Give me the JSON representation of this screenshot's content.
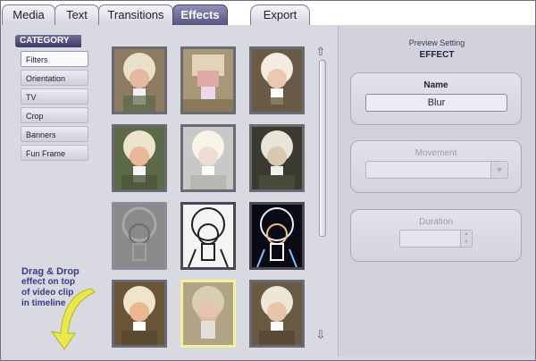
{
  "tabs": {
    "media": "Media",
    "text": "Text",
    "transitions": "Transitions",
    "effects": "Effects",
    "export": "Export"
  },
  "category": {
    "header": "CATEGORY",
    "items": [
      "Filters",
      "Orientation",
      "TV",
      "Crop",
      "Banners",
      "Fun Frame"
    ],
    "selected": "Filters"
  },
  "drag_hint": {
    "line1": "Drag & Drop",
    "line2": "effect on top",
    "line3": "of video clip",
    "line4": "in timeline"
  },
  "preview": {
    "title": "Preview Setting",
    "subtitle": "EFFECT",
    "name_label": "Name",
    "name_value": "Blur",
    "movement_label": "Movement",
    "duration_label": "Duration"
  },
  "colors": {
    "active_tab": "#55557f",
    "selected_thumb_border": "#f2f29a",
    "hint_text": "#3a3a88"
  }
}
